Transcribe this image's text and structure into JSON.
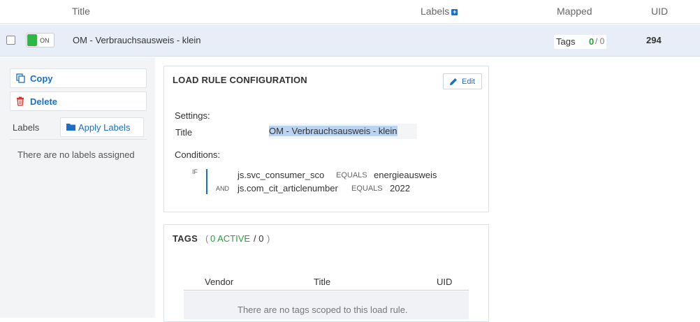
{
  "header": {
    "title_col": "Title",
    "labels_col": "Labels",
    "labels_add_icon": "plus-icon",
    "mapped_col": "Mapped",
    "uid_col": "UID"
  },
  "row": {
    "toggle_label": "ON",
    "toggle_color": "#2db843",
    "title": "OM - Verbrauchsausweis - klein",
    "tags_label": "Tags",
    "tags_active": "0",
    "tags_total": "/ 0",
    "uid": "294"
  },
  "actions": {
    "copy_label": "Copy",
    "copy_icon": "copy-icon",
    "delete_label": "Delete",
    "delete_icon": "trash-icon",
    "labels_heading": "Labels",
    "apply_labels": "Apply Labels",
    "apply_icon": "folder-icon",
    "no_labels": "There are no labels assigned"
  },
  "load_rule": {
    "heading": "LOAD RULE CONFIGURATION",
    "edit_label": "Edit",
    "edit_icon": "pencil-icon",
    "settings_heading": "Settings:",
    "title_label": "Title",
    "title_value": "OM - Verbrauchsausweis - klein",
    "conditions_heading": "Conditions:",
    "if_label": "IF",
    "and_label": "AND",
    "conditions": [
      {
        "variable": "js.svc_consumer_sco",
        "operator": "EQUALS",
        "value": "energieausweis"
      },
      {
        "variable": "js.com_cit_articlenumber",
        "operator": "EQUALS",
        "value": "2022"
      }
    ]
  },
  "tags": {
    "heading": "TAGS",
    "open_paren": "(",
    "active": "0 ACTIVE",
    "total": "/ 0",
    "close_paren": ")",
    "columns": [
      "Vendor",
      "Title",
      "UID"
    ],
    "empty_text": "There are no tags scoped to this load rule."
  },
  "colors": {
    "accent": "#1a6fc9",
    "active_green": "#2a9d3a",
    "delete_red": "#d9342b"
  }
}
